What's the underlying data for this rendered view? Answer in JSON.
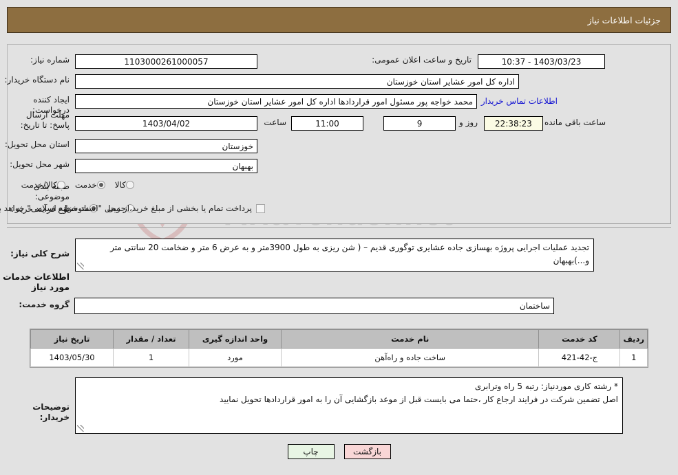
{
  "header": {
    "title": "جزئیات اطلاعات نیاز"
  },
  "main_form": {
    "need_number": {
      "label": "شماره نیاز:",
      "value": "1103000261000057"
    },
    "announce_datetime": {
      "label": "تاریخ و ساعت اعلان عمومی:",
      "value": "1403/03/23 - 10:37"
    },
    "buyer_org": {
      "label": "نام دستگاه خریدار:",
      "value": "اداره کل امور عشایر استان خوزستان"
    },
    "requester": {
      "label": "ایجاد کننده درخواست:",
      "value": "محمد خواجه پور مسئول امور قراردادها اداره کل امور عشایر استان خوزستان"
    },
    "contact_link": "اطلاعات تماس خریدار",
    "deadline": {
      "label": "مهلت ارسال پاسخ: تا تاریخ:",
      "date": "1403/04/02",
      "time_label": "ساعت",
      "time": "11:00",
      "days": "9",
      "days_label": "روز و",
      "countdown": "22:38:23",
      "countdown_label": "ساعت باقی مانده"
    },
    "delivery_province": {
      "label": "استان محل تحویل:",
      "value": "خوزستان"
    },
    "delivery_city": {
      "label": "شهر محل تحویل:",
      "value": "بهبهان"
    },
    "category": {
      "label": "طبقه بندی موضوعی:",
      "options": [
        {
          "label": "کالا",
          "selected": false
        },
        {
          "label": "خدمت",
          "selected": true
        },
        {
          "label": "کالا/خدمت",
          "selected": false
        }
      ]
    },
    "purchase_type": {
      "label": "نوع فرآیند خرید :",
      "options": [
        {
          "label": "جزیی",
          "selected": false
        },
        {
          "label": "متوسط",
          "selected": true
        }
      ],
      "checkbox_text": "پرداخت تمام یا بخشی از مبلغ خرید،از محل \"اسناد خزانه اسلامی\" خواهد بود.",
      "checkbox_checked": false
    }
  },
  "description": {
    "label": "شرح کلی نیاز:",
    "value": "تجدید عملیات اجرایی پروژه بهسازی جاده عشایری توگوری قدیم – ( شن ریزی به طول 3900متر و به عرض 6 متر و ضخامت 20 سانتی متر و...)بهبهان"
  },
  "services_section": {
    "heading": "اطلاعات خدمات مورد نیاز",
    "service_group": {
      "label": "گروه خدمت:",
      "value": "ساختمان"
    },
    "table": {
      "columns": [
        "ردیف",
        "کد خدمت",
        "نام خدمت",
        "واحد اندازه گیری",
        "تعداد / مقدار",
        "تاریخ نیاز"
      ],
      "rows": [
        [
          "1",
          "ج-42-421",
          "ساخت جاده و راه‌آهن",
          "مورد",
          "1",
          "1403/05/30"
        ]
      ]
    }
  },
  "buyer_notes": {
    "label": "توضیحات خریدار:",
    "value": "* رشته کاری موردنیاز:   رتبه 5 راه وترابری\nاصل تضمین شرکت در فرایند ارجاع کار ،حتما می بایست قبل از موعد بازگشایی  آن را به امور قراردادها تحویل نمایید"
  },
  "buttons": {
    "print": "چاپ",
    "back": "بازگشت"
  },
  "watermark": {
    "text": "AriaTender.net"
  },
  "colors": {
    "header_bg": "#8d6e40",
    "page_bg": "#e2e2e2",
    "link": "#1414d2",
    "btn_print_bg": "#e8f5e4",
    "btn_back_bg": "#f9d6d6",
    "countdown_bg": "#fbfbe4",
    "table_header_bg": "#bfbfbf"
  }
}
